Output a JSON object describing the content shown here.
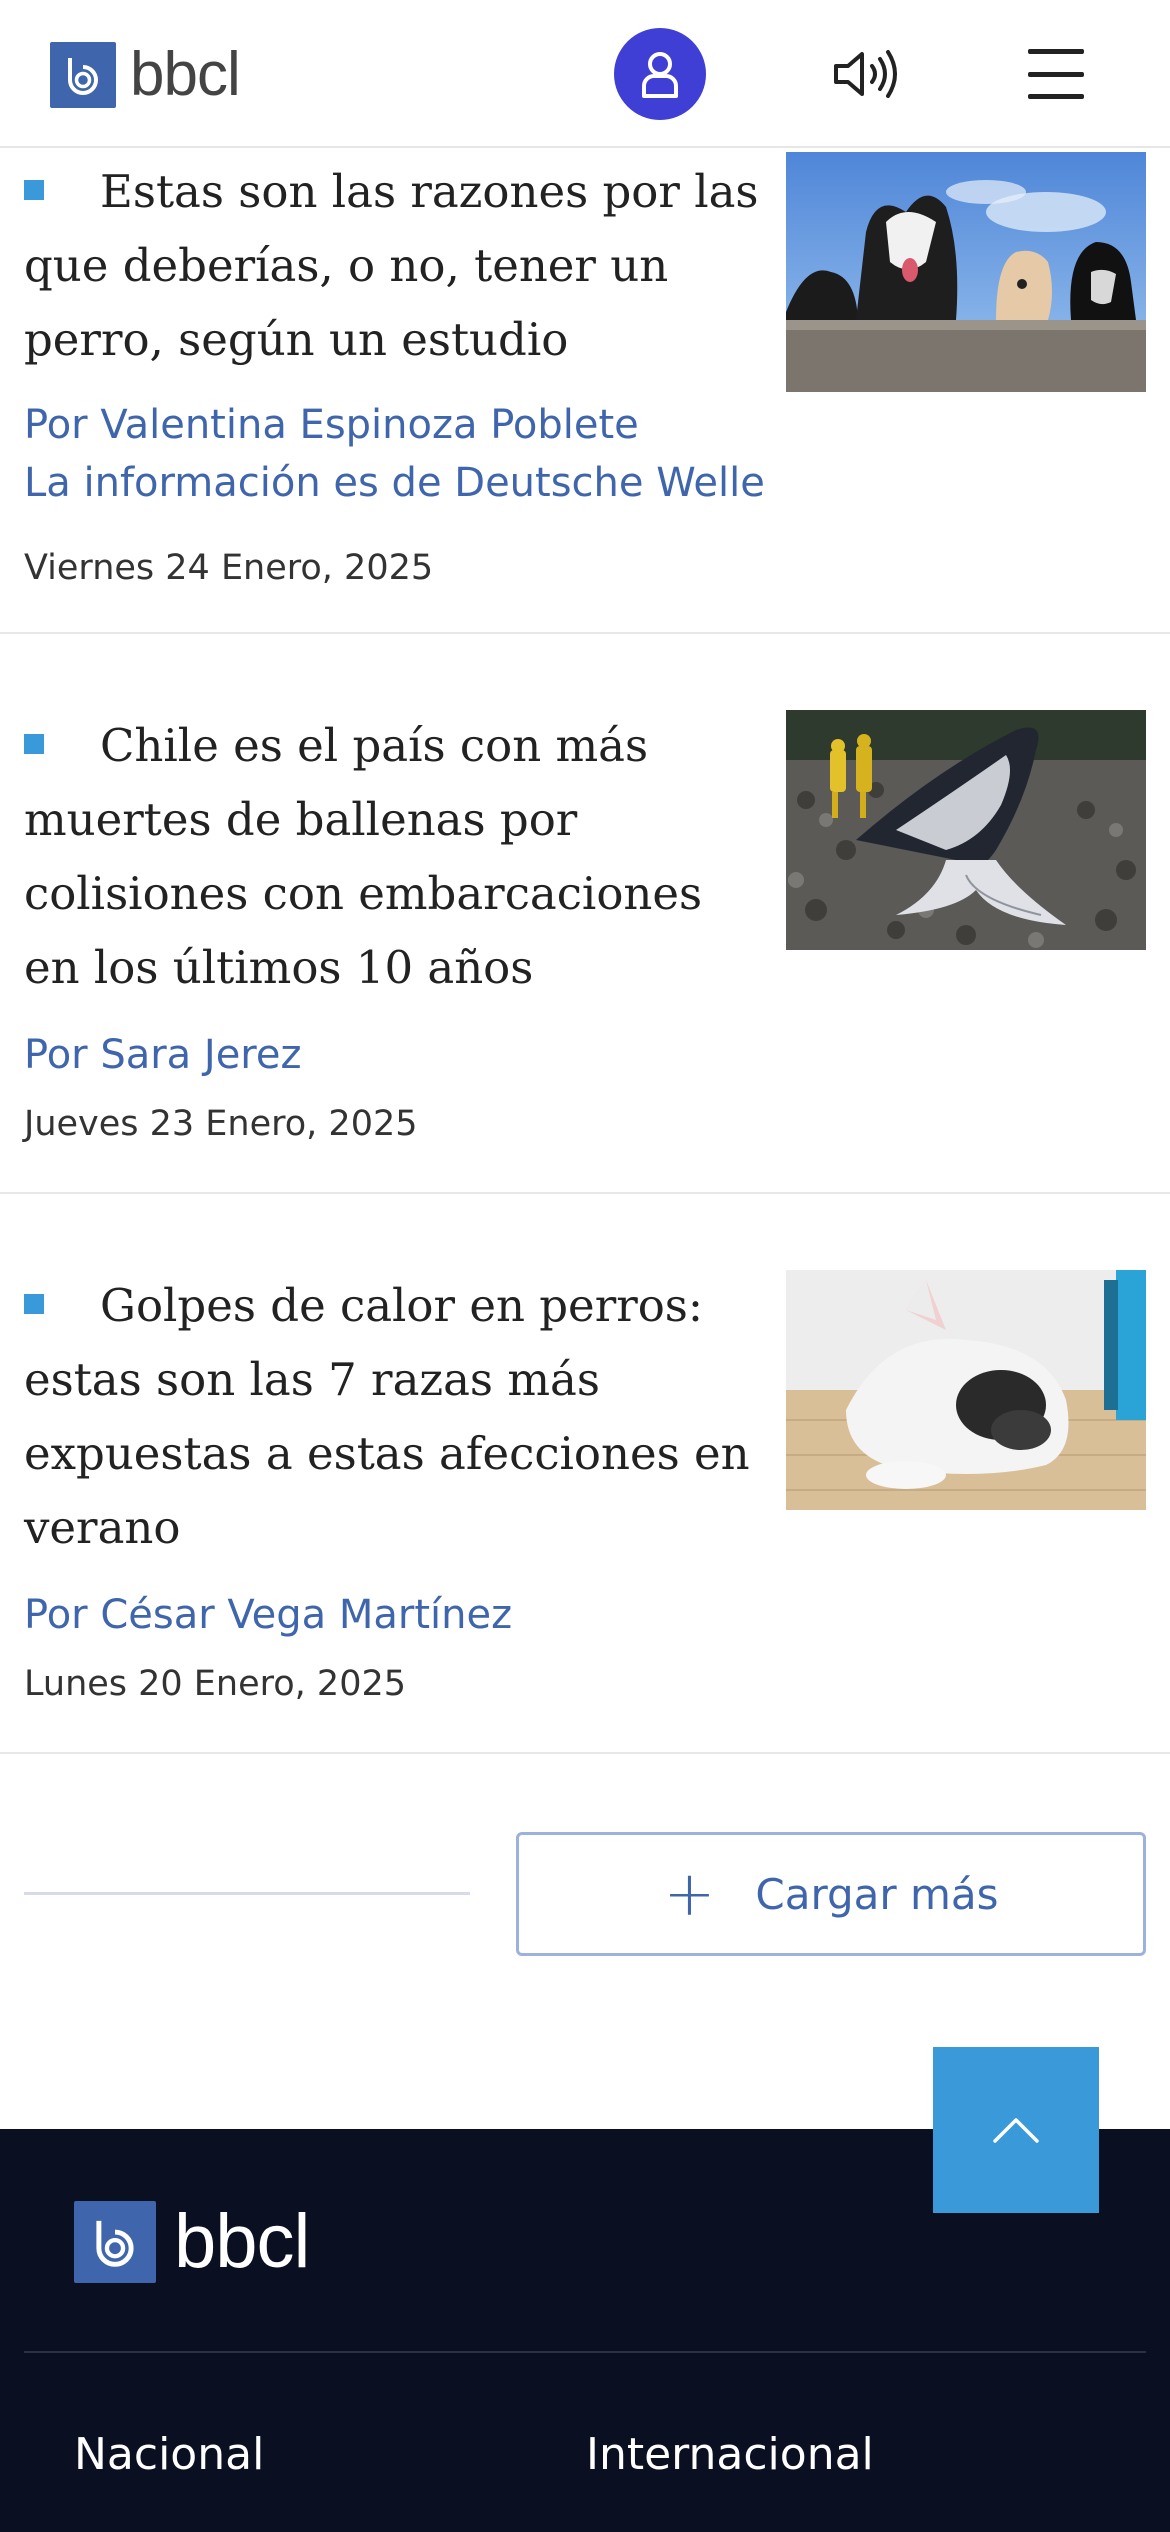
{
  "header": {
    "logo_text": "bbcl",
    "accent": "#3f3fd6",
    "icons": [
      "user-icon",
      "speaker-icon",
      "menu-icon"
    ]
  },
  "articles": [
    {
      "title": "Estas son las razones por las que deberías, o no, tener un perro, según un estudio",
      "author": "Por Valentina Espinoza Poblete",
      "source": "La información es de Deutsche Welle",
      "date": "Viernes 24 Enero, 2025",
      "image": "dogs-over-wall"
    },
    {
      "title": "Chile es el país con más muertes de ballenas por colisiones con embarcaciones en los últimos 10 años",
      "author": "Por Sara Jerez",
      "date": "Jueves 23 Enero, 2025",
      "image": "stranded-whale"
    },
    {
      "title": "Golpes de calor en perros: estas son las 7 razas más expuestas a estas afecciones en verano",
      "author": "Por César Vega Martínez",
      "date": "Lunes 20 Enero, 2025",
      "image": "french-bulldog-sleeping"
    }
  ],
  "load_more": {
    "label": "Cargar más",
    "icon": "plus-icon"
  },
  "back_to_top": {
    "icon": "chevron-up-icon",
    "color": "#3a9ad9"
  },
  "footer": {
    "logo_text": "bbcl",
    "background": "#0b0f22",
    "links": [
      "Nacional",
      "Internacional"
    ]
  }
}
